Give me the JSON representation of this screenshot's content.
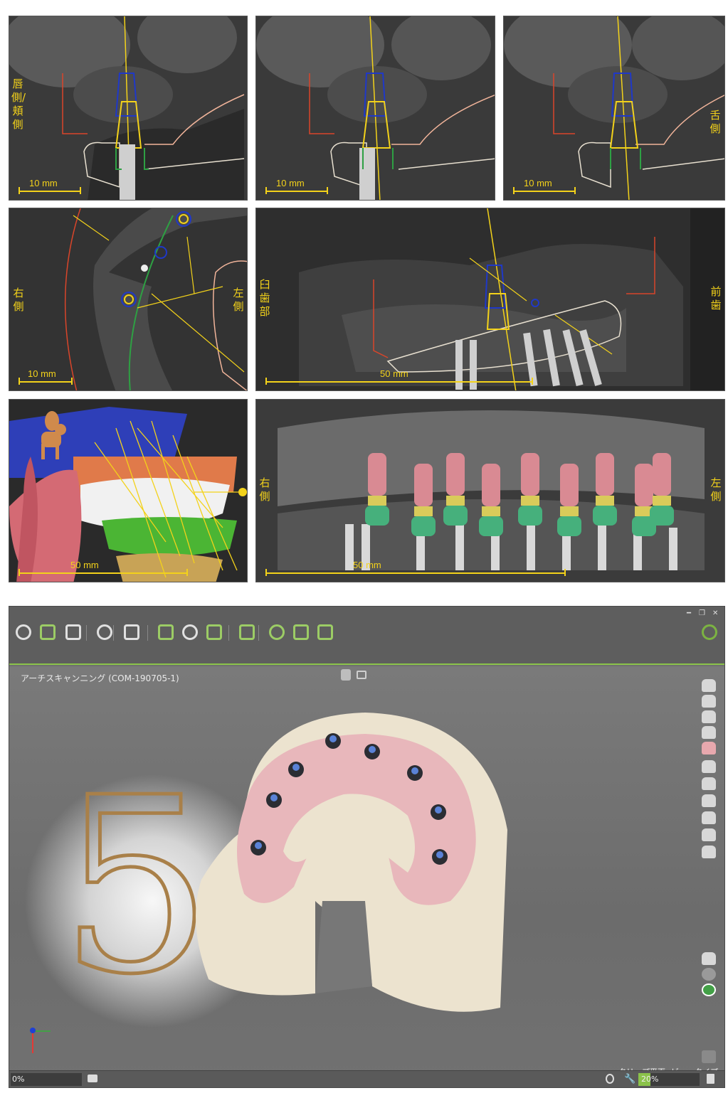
{
  "panels": {
    "cs1": {
      "side_label": "唇側/頬側",
      "scale": "10 mm"
    },
    "cs2": {
      "scale": "10 mm"
    },
    "cs3": {
      "side_label": "舌側",
      "scale": "10 mm"
    },
    "axial": {
      "left_label": "右側",
      "right_label": "左側",
      "scale": "10 mm"
    },
    "sagittal": {
      "left_label": "臼歯部",
      "right_label": "前歯",
      "scale": "50 mm"
    },
    "render3d": {
      "scale": "50 mm"
    },
    "pano": {
      "left_label": "右側",
      "right_label": "左側",
      "scale": "50 mm"
    }
  },
  "app": {
    "viewport_title": "アーチスキャンニング (COM-190705-1)",
    "watermark_digit": "5",
    "bottom_right_labels": {
      "clip": "クリップ平面",
      "view": "ビュータイプ"
    },
    "status": {
      "left_value": "0%",
      "zoom_value": "20%"
    },
    "zoom_fill": 0.2,
    "accent_color": "#8bc34a",
    "toolbar_icons": [
      "arch-scan-icon",
      "dental-arch-icon",
      "scanner-icon",
      "factory-icon",
      "cad-icon",
      "clipboard-icon",
      "doctor-icon",
      "settings-icon",
      "refresh-icon",
      "globe-icon",
      "lifebuoy-icon",
      "power-icon",
      "app-logo-icon"
    ]
  }
}
